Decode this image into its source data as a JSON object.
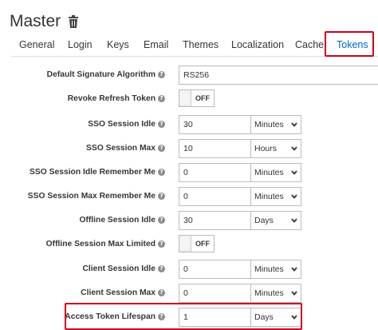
{
  "header": {
    "title": "Master",
    "trash_icon": "trash-icon"
  },
  "tabs": [
    {
      "label": "General"
    },
    {
      "label": "Login"
    },
    {
      "label": "Keys"
    },
    {
      "label": "Email"
    },
    {
      "label": "Themes"
    },
    {
      "label": "Localization"
    },
    {
      "label": "Cache"
    },
    {
      "label": "Tokens",
      "active": true
    }
  ],
  "form": {
    "default_sig_alg": {
      "label": "Default Signature Algorithm",
      "value": "RS256"
    },
    "revoke_refresh": {
      "label": "Revoke Refresh Token",
      "state": "OFF"
    },
    "sso_idle": {
      "label": "SSO Session Idle",
      "value": "30",
      "unit": "Minutes"
    },
    "sso_max": {
      "label": "SSO Session Max",
      "value": "10",
      "unit": "Hours"
    },
    "sso_idle_rm": {
      "label": "SSO Session Idle Remember Me",
      "value": "0",
      "unit": "Minutes"
    },
    "sso_max_rm": {
      "label": "SSO Session Max Remember Me",
      "value": "0",
      "unit": "Minutes"
    },
    "offline_idle": {
      "label": "Offline Session Idle",
      "value": "30",
      "unit": "Days"
    },
    "offline_max_limited": {
      "label": "Offline Session Max Limited",
      "state": "OFF"
    },
    "client_idle": {
      "label": "Client Session Idle",
      "value": "0",
      "unit": "Minutes"
    },
    "client_max": {
      "label": "Client Session Max",
      "value": "0",
      "unit": "Minutes"
    },
    "access_lifespan": {
      "label": "Access Token Lifespan",
      "value": "1",
      "unit": "Days"
    }
  },
  "help_glyph": "?",
  "colors": {
    "active_tab": "#0066cc",
    "highlight": "#d0021b"
  }
}
